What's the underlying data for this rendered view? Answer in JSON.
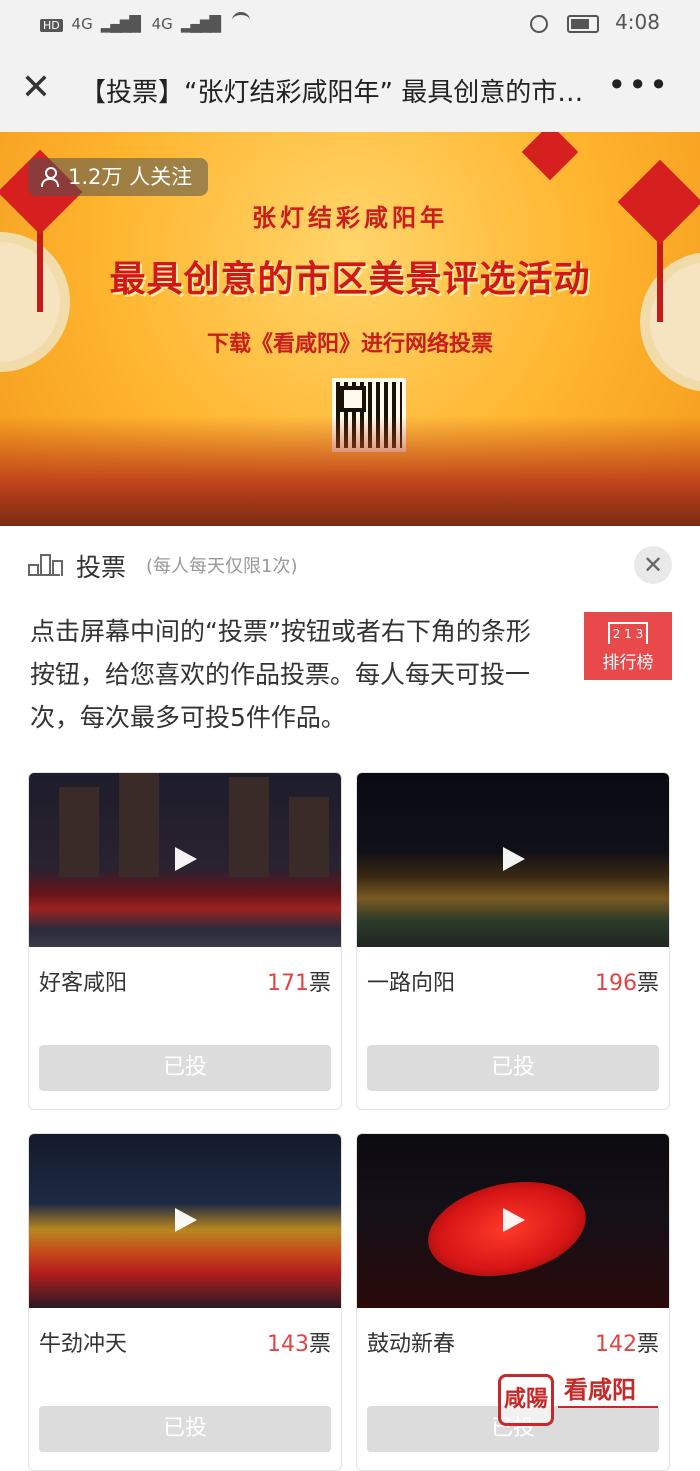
{
  "status_bar": {
    "hd_label": "HD",
    "network1": "4G",
    "network2": "4G",
    "time": "4:08"
  },
  "nav": {
    "title": "【投票】“张灯结彩咸阳年” 最具创意的市…",
    "close_icon": "close-icon",
    "more_icon": "more-icon"
  },
  "banner": {
    "followers": "1.2万 人关注",
    "subtitle": "张灯结彩咸阳年",
    "title": "最具创意的市区美景评选活动",
    "download_text": "下载《看咸阳》进行网络投票"
  },
  "vote_panel": {
    "label": "投票",
    "note": "(每人每天仅限1次)",
    "instruction": "点击屏幕中间的“投票”按钮或者右下角的条形按钮，给您喜欢的作品投票。每人每天可投一次，每次最多可投5件作品。",
    "rank_button": "排行榜",
    "rank_icon_text": "2 1 3"
  },
  "items": [
    {
      "name": "好客咸阳",
      "votes": "171",
      "unit": "票",
      "button": "已投"
    },
    {
      "name": "一路向阳",
      "votes": "196",
      "unit": "票",
      "button": "已投"
    },
    {
      "name": "牛劲冲天",
      "votes": "143",
      "unit": "票",
      "button": "已投"
    },
    {
      "name": "鼓动新春",
      "votes": "142",
      "unit": "票",
      "button": "已投"
    }
  ],
  "watermark": {
    "logo": "咸陽",
    "name": "看咸阳"
  },
  "colors": {
    "accent_red": "#e14444",
    "rank_button_bg": "#e8494a",
    "voted_button_bg": "#dcdcdc"
  }
}
